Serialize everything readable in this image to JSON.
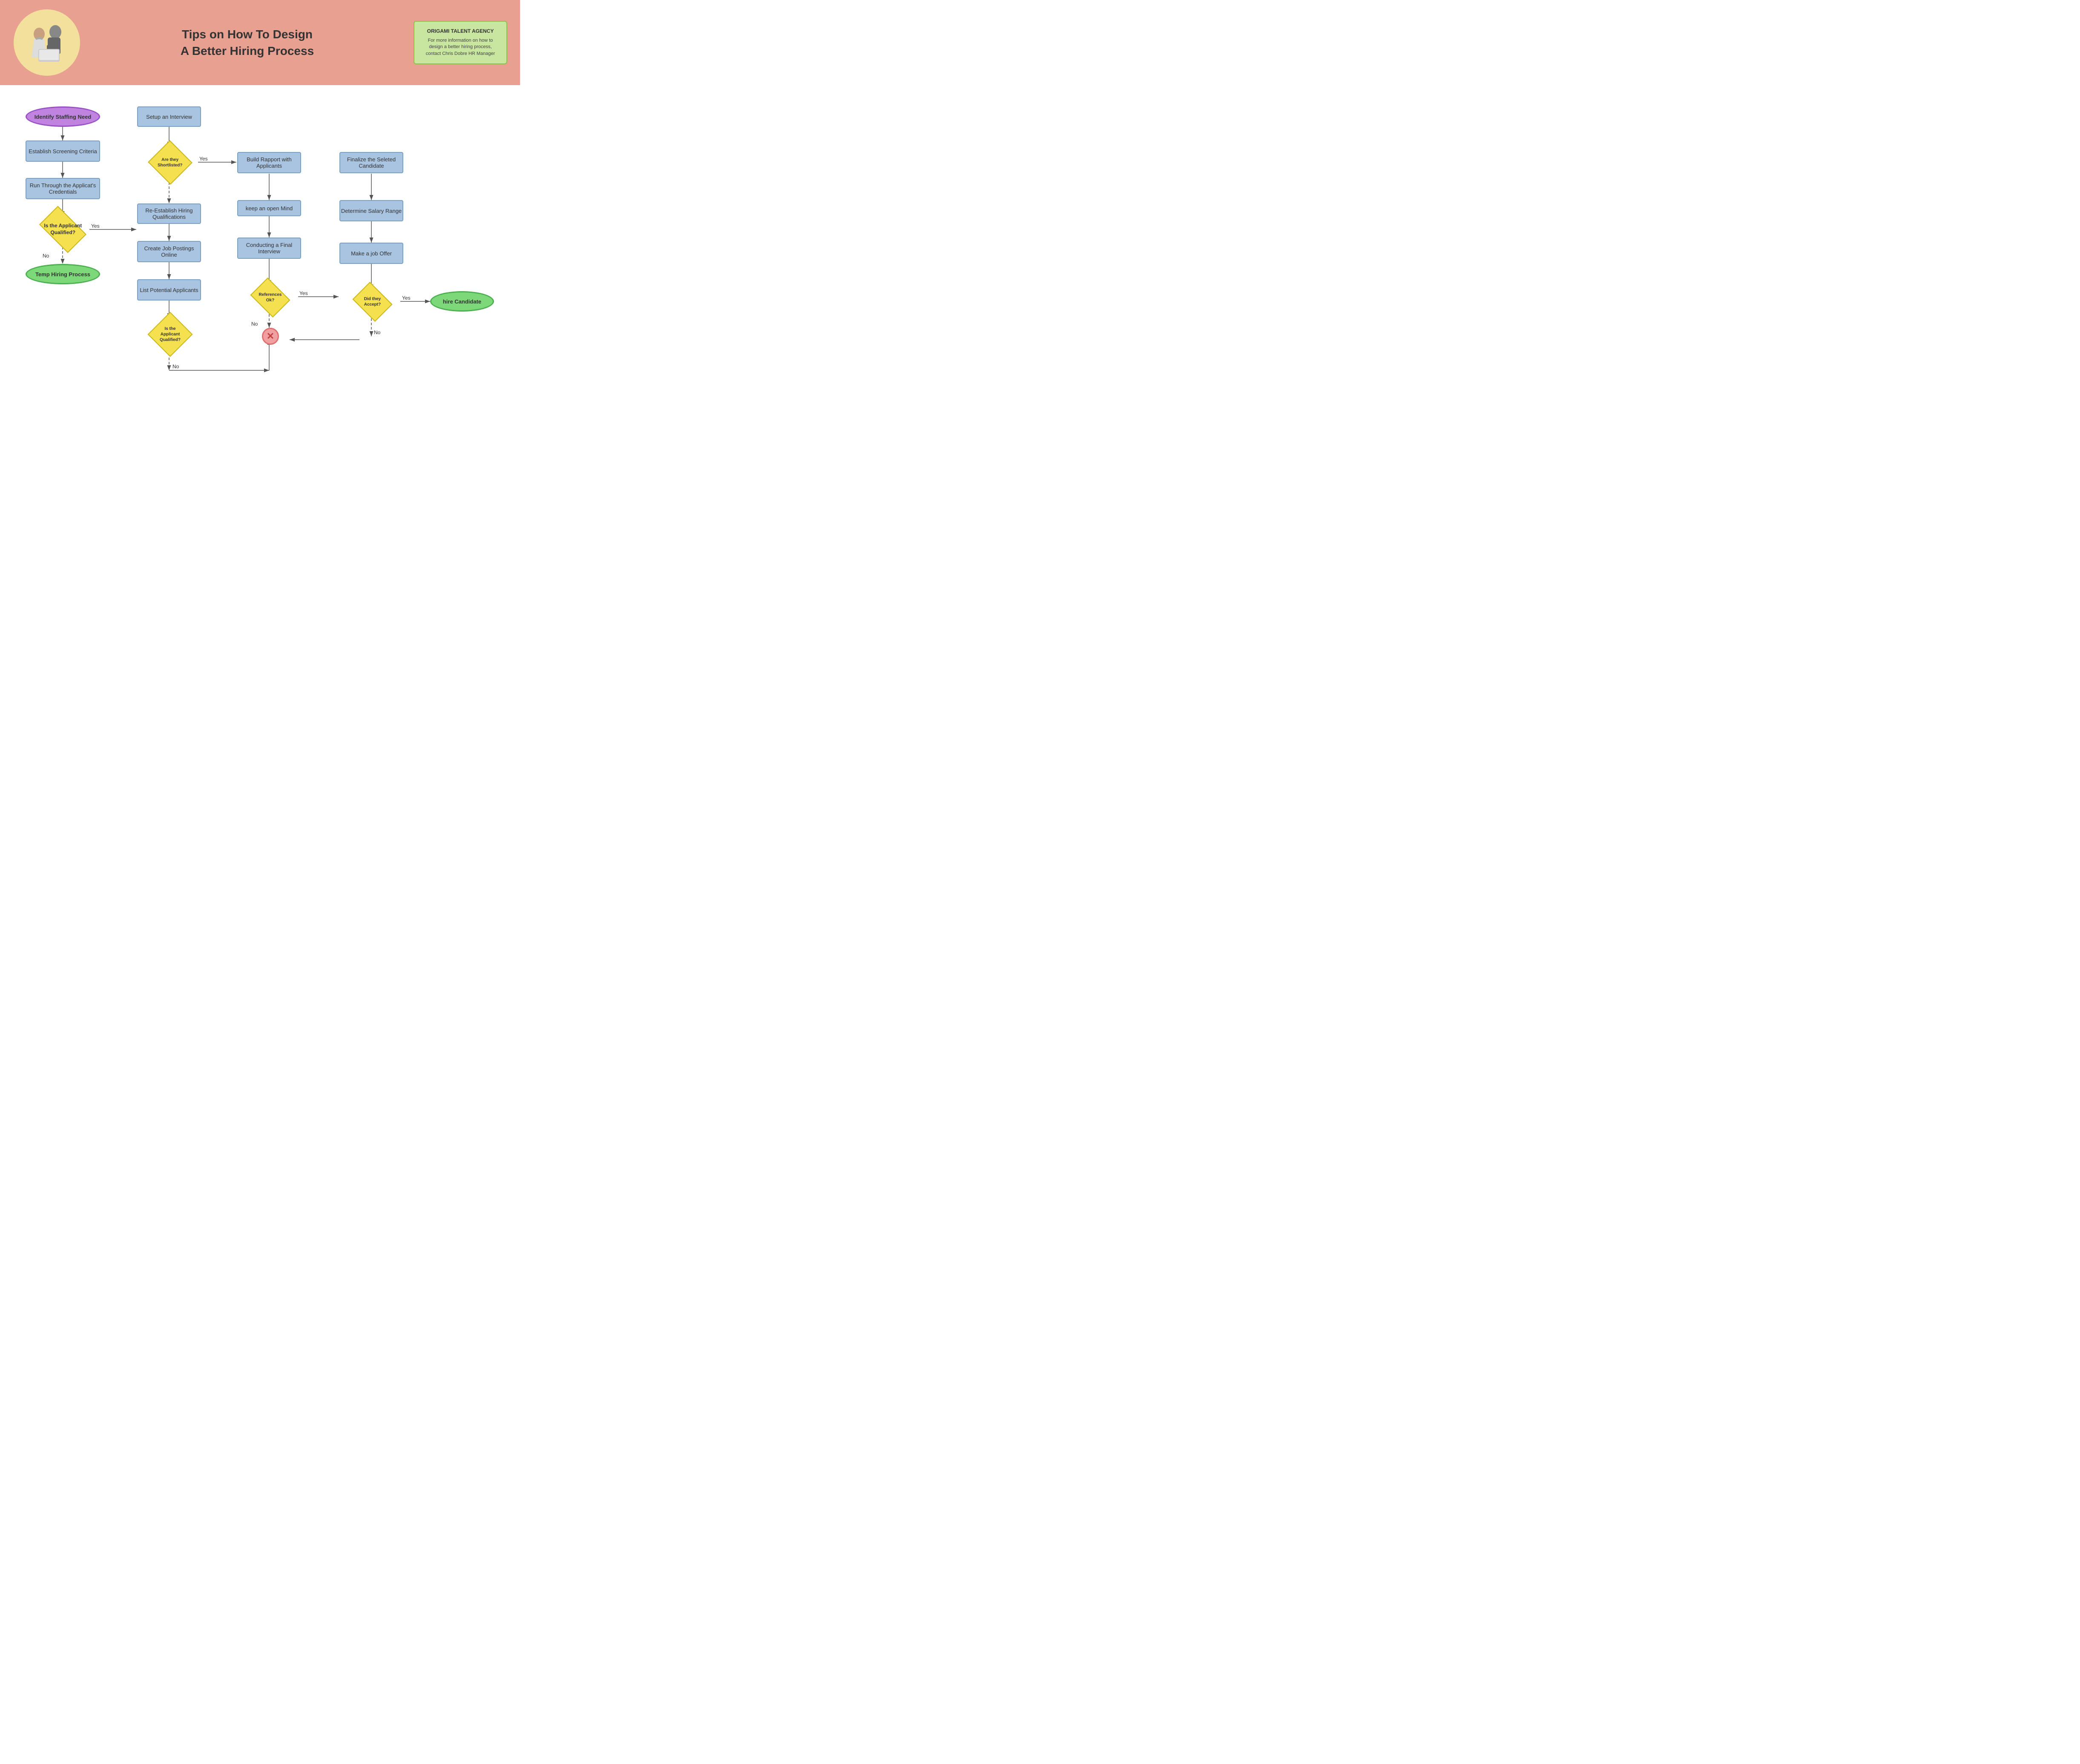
{
  "header": {
    "title_line1": "Tips on How To Design",
    "title_line2": "A Better Hiring Process",
    "info_title": "ORIGAMI TALENT AGENCY",
    "info_text": "For more information on how to design a better hiring process, contact Chris Dobre HR Manager"
  },
  "nodes": {
    "identify_staffing": "Identify Staffing Need",
    "establish_screening": "Establish Screening Criteria",
    "run_through": "Run Through the Applicat's Credentials",
    "is_qualified_1": "Is the Applicant Qualified?",
    "temp_hiring": "Temp Hiring Process",
    "setup_interview": "Setup an Interview",
    "are_shortlisted": "Are they Shortlisted?",
    "re_establish": "Re-Establish Hiring Qualifications",
    "create_postings": "Create Job Postings Online",
    "list_applicants": "List Potential Applicants",
    "is_qualified_2": "Is the Applicant Qualified?",
    "build_rapport": "Build Rapport with Applicants",
    "keep_open_mind": "keep an open Mind",
    "conducting_final": "Conducting a Final Interview",
    "references_ok": "References Ok?",
    "finalize_candidate": "Finalize the Seleted Candidate",
    "determine_salary": "Determine Salary Range",
    "make_offer": "Make a job Offer",
    "did_accept": "Did they Accept?",
    "hire_candidate": "hire Candidate",
    "cross_circle": "✕"
  },
  "labels": {
    "yes": "Yes",
    "no": "No"
  }
}
